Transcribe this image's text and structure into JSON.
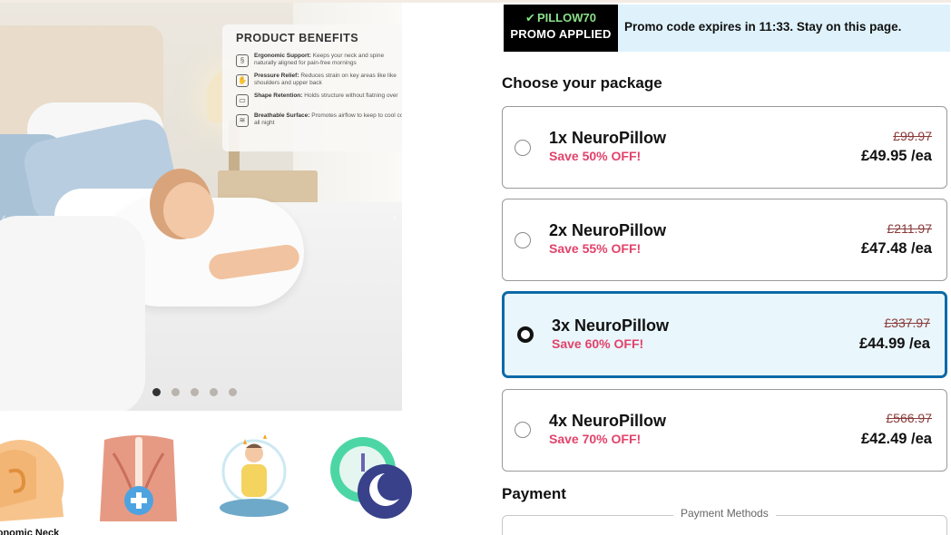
{
  "promo": {
    "code": "PILLOW70",
    "status": "PROMO APPLIED",
    "message": "Promo code expires in 11:33. Stay on this page."
  },
  "hero": {
    "benefits_title": "PRODUCT BENEFITS",
    "benefits": [
      {
        "title": "Ergonomic Support:",
        "desc": "Keeps your neck and spine naturally aligned for pain-free mornings"
      },
      {
        "title": "Pressure Relief:",
        "desc": "Reduces strain on key areas like like shoulders and upper back"
      },
      {
        "title": "Shape Retention:",
        "desc": "Holds structure without flatning over"
      },
      {
        "title": "Breathable Surface:",
        "desc": "Promotes airflow to keep to cool col all night"
      }
    ],
    "carousel_total": 5,
    "carousel_active": 1
  },
  "feature_icons": {
    "neck_caption": "gonomic Neck"
  },
  "packages": {
    "title": "Choose your package",
    "items": [
      {
        "name": "1x NeuroPillow",
        "save": "Save 50% OFF!",
        "old_price": "£99.97",
        "price": "£49.95 /ea",
        "selected": false
      },
      {
        "name": "2x NeuroPillow",
        "save": "Save 55% OFF!",
        "old_price": "£211.97",
        "price": "£47.48 /ea",
        "selected": false
      },
      {
        "name": "3x NeuroPillow",
        "save": "Save 60% OFF!",
        "old_price": "£337.97",
        "price": "£44.99 /ea",
        "selected": true
      },
      {
        "name": "4x NeuroPillow",
        "save": "Save 70% OFF!",
        "old_price": "£566.97",
        "price": "£42.49 /ea",
        "selected": false
      }
    ]
  },
  "payment": {
    "title": "Payment",
    "methods_label": "Payment Methods"
  },
  "colors": {
    "accent": "#0c6aa8",
    "save_text": "#e2426a",
    "promo_bg": "#dff2fb",
    "selected_bg": "#e9f6fb"
  }
}
